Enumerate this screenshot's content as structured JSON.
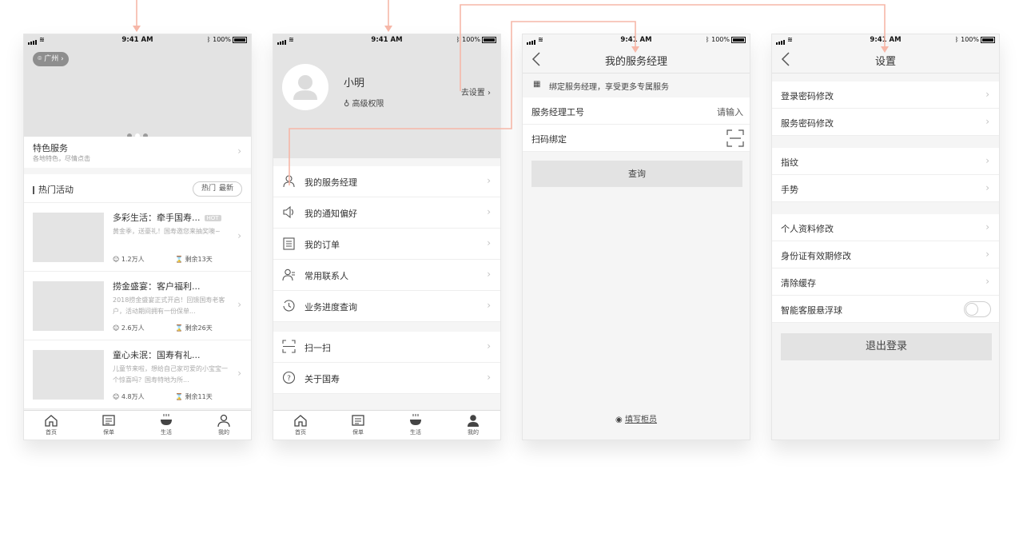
{
  "status": {
    "time": "9:41 AM",
    "battery": "100%"
  },
  "home": {
    "location": "广州",
    "feature": {
      "title": "特色服务",
      "subtitle": "各地特色，尽情点击"
    },
    "hot_section": {
      "title": "热门活动",
      "tab_hot": "热门",
      "tab_new": "最新"
    },
    "activities": [
      {
        "title": "多彩生活：牵手国寿...",
        "badge": "HOT",
        "desc": "黄金季，送豪礼！国寿邀您来抽奖噢~",
        "people": "1.2万人",
        "remain": "剩余13天"
      },
      {
        "title": "捞金盛宴：客户福利...",
        "badge": "",
        "desc": "2018捞金盛宴正式开启！回馈国寿老客户，活动期间拥有一份保单...",
        "people": "2.6万人",
        "remain": "剩余26天"
      },
      {
        "title": "童心未泯：国寿有礼...",
        "badge": "",
        "desc": "儿童节来啦，想给自己家可爱的小宝宝一个惊喜吗？国寿特地为所...",
        "people": "4.8万人",
        "remain": "剩余11天"
      }
    ]
  },
  "tabs": [
    "首页",
    "保单",
    "生活",
    "我的"
  ],
  "profile": {
    "name": "小明",
    "level": "高级权限",
    "settings_link": "去设置",
    "menu": [
      "我的服务经理",
      "我的通知偏好",
      "我的订单",
      "常用联系人",
      "业务进度查询"
    ],
    "menu2": [
      "扫一扫",
      "关于国寿"
    ]
  },
  "manager": {
    "title": "我的服务经理",
    "tip": "绑定服务经理，享受更多专属服务",
    "id_label": "服务经理工号",
    "id_placeholder": "请输入",
    "scan_label": "扫码绑定",
    "query_button": "查询",
    "footer_link": "填写柜员"
  },
  "settings": {
    "title": "设置",
    "group1": [
      "登录密码修改",
      "服务密码修改"
    ],
    "group2": [
      "指纹",
      "手势"
    ],
    "group3": [
      "个人资料修改",
      "身份证有效期修改",
      "清除缓存"
    ],
    "toggle_label": "智能客服悬浮球",
    "logout_button": "退出登录"
  },
  "colors": {
    "flow_line": "#f6b7a8",
    "placeholder": "#e4e4e4"
  }
}
